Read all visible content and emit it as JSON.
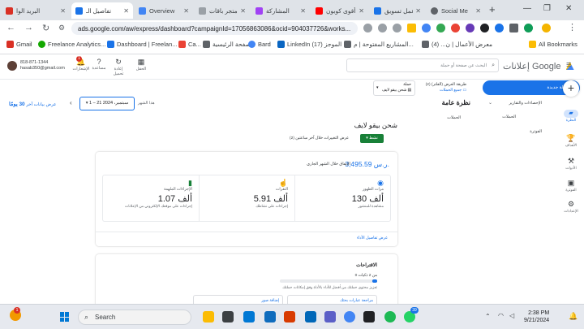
{
  "browser": {
    "tabs": [
      {
        "title": "البريد الوا",
        "color": "#d93025",
        "active": false
      },
      {
        "title": "تفاصيل الـ",
        "color": "#1a73e8",
        "active": true
      },
      {
        "title": "Overview",
        "color": "#4285f4",
        "active": false
      },
      {
        "title": "متجر باقات",
        "color": "#9aa0a6",
        "active": false
      },
      {
        "title": "المشاركة",
        "color": "#a142f4",
        "active": false
      },
      {
        "title": "أقوى كوبون",
        "color": "#ff0000",
        "active": false
      },
      {
        "title": "عمل تسويق",
        "color": "#1a73e8",
        "active": false
      },
      {
        "title": "Social Me",
        "color": "#5f6368",
        "active": false
      }
    ],
    "url": "ads.google.com/aw/express/dashboard?campaignId=17056863086&ocid=904037726&works...",
    "bookmarks": [
      {
        "label": "Gmail",
        "color": "#d93025"
      },
      {
        "label": "Freelance Analytics...",
        "color": "#14a800"
      },
      {
        "label": "Dashboard | Freelan...",
        "color": "#1a73e8"
      },
      {
        "label": "Ca...",
        "color": "#ea4335"
      },
      {
        "label": "الصفحة الرئيسية",
        "color": "#5f6368"
      },
      {
        "label": "Bard",
        "color": "#4285f4"
      },
      {
        "label": "LinkedIn (17) الموجز",
        "color": "#0a66c2"
      },
      {
        "label": "المشاريع المفتوحة | م...",
        "color": "#5f6368"
      },
      {
        "label": "معرض الأعمال | ن... (4)",
        "color": "#5f6368"
      }
    ],
    "all_bookmarks": "All Bookmarks"
  },
  "header": {
    "account_number": "818-871-1344",
    "account_email": "hasab350@gmail.com",
    "notifications_label": "الإشعارات",
    "notifications_count": "1",
    "help_label": "مساعدة",
    "refresh_label": "إعادة تحميل",
    "tools_label": "الحقل",
    "search_placeholder": "البحث عن صفحة أو حملة",
    "logo_text": "إعلانات Google"
  },
  "subheader": {
    "show_last_label": "عرض بيانات آخر",
    "show_last_value": "30 يومًا",
    "date_prefix": "هذا الشهر",
    "date_range": "1 – 21 سبتمبر، 2024",
    "campaign_filter_label": "حملة",
    "campaign_filter_value": "شحن بيقو لايف",
    "campaign_type_label": "طريقة العرض (الفلتر) (2)",
    "campaign_type_value": "جميع الحملات"
  },
  "sidebar": {
    "new_campaign": "حملة جديدة",
    "stats_menu": "الإحصاءات والتقارير",
    "campaigns_menu": "الحملات",
    "billing_menu": "الفوترة"
  },
  "rail": {
    "overview": "النظرة",
    "goals": "الأهداف",
    "tools": "الأدوات",
    "billing": "الفوترة",
    "settings": "الإعدادات"
  },
  "main": {
    "section_title": "نظرة عامة",
    "campaigns_link": "الحملات",
    "campaign_name": "شحن بيقو لايف",
    "status_button": "نشط",
    "view_changes": "عرض التغييرات خلال آخر ساعتين (2)",
    "spend_value": "3,495.59 ر.س.",
    "spend_label": "الإنفاق خلال الشهر الجاري",
    "metrics": [
      {
        "icon": "eye-icon",
        "label": "مرات الظهور",
        "value": "130 ألف",
        "sub": "مشاهدة للمنشور"
      },
      {
        "icon": "click-icon",
        "label": "النقرات",
        "value": "5.91 ألف",
        "sub": "إجراءات على نشاطك"
      },
      {
        "icon": "chart-icon",
        "label": "الإجراءات الملهمة",
        "value": "1.07 ألف",
        "sub": "إجراءات على موقعك الإلكتروني من الإعلانات"
      }
    ],
    "details_link": "عرض تفاصيل الأداء",
    "reco_title": "الاقتراحات",
    "reco_progress_text": "0 من 2 ذكيات",
    "reco_progress": 0.05,
    "reco_desc": "تعزيز محتوى حملتك من أفضل للأداء بالأداة وفق إمكانات حملتك",
    "sub_card1": "مراجعة عبارات بحثك",
    "sub_card2": "إضافة صور"
  },
  "taskbar": {
    "search_placeholder": "Search",
    "time": "2:38 PM",
    "date": "9/21/2024",
    "weather_badge": "1",
    "whatsapp_badge": "39"
  }
}
